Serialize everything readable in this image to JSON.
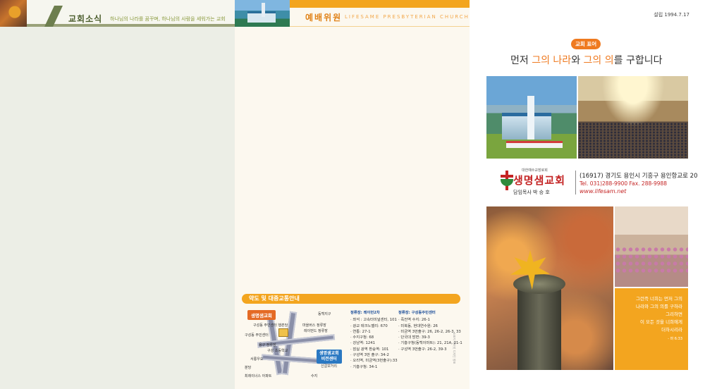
{
  "panel1": {
    "title": "교회소식",
    "subtitle": "하나님의 나라를 꿈꾸며, 하나님의 사람을 세워가는 교회"
  },
  "panel2": {
    "title": "예배위원",
    "subtitle": "LIFESAME PRESBYTERIAN CHURCH",
    "map": {
      "heading": "약도 및 대중교통안내",
      "church_label": "생명샘교회",
      "vision_label_1": "생명샘교회",
      "vision_label_2": "비전센터",
      "labels": [
        "구성동 주민센터 행촌당",
        "구성동 주민센터",
        "마을버스 정류장",
        "레이먼드 정류장",
        "동백지구",
        "용구 정류장",
        "구성 초등학교",
        "서룡우오",
        "분당",
        "최레이너스 아파트",
        "수지",
        "신갈오거리"
      ]
    },
    "bus_left": {
      "title": "정류장: 레이먼2차",
      "items": [
        "· 좌석 : 고속터미널센터, 101",
        "· 광교 테크노밸리: 670",
        "· 연통: 27-1",
        "· 수지구청: 68",
        "· 강남역: 1241",
        "· 잠실 광역 환승역: 101",
        "· 구성역 3번 출구: 34-2",
        "· 오리역, 미금역(3번출구):33",
        "· 기흥구청: 34-1"
      ]
    },
    "bus_right": {
      "title": "정류장: 구성동주민센터",
      "items": [
        "· 죽전역 수지: 26-1",
        "· 미북동, 현대연수원: 26",
        "· 미금역 3번출구: 26, 26-2, 26-3, 33",
        "· 단국대 방면: 39-3",
        "· 기흥구청(동백이마트): 21, 21A, 21-1",
        "· 구성역 3번출구: 26-2, 39-3"
      ]
    },
    "side_note": "소표지 캐비넷 디자인 발표"
  },
  "panel3": {
    "established": "설립 1994.7.17",
    "motto_badge": "교회 표어",
    "motto_a": "먼저 ",
    "motto_b": "그의 나라",
    "motto_c": "와 ",
    "motto_d": "그의 의",
    "motto_e": "를 구합니다",
    "denomination": "대한예수교장로회",
    "church_name": "생명샘교회",
    "pastor": "담임목사  박 승 호",
    "address": "(16917) 경기도 용인시 기흥구 용인항교로 20",
    "tel": "Tel. 031)288-9900   Fax. 288-9988",
    "website": "www.lifesam.net",
    "verse_lines": [
      "그런즉 너희는 먼저 그의",
      "나라와 그의 의를 구하라",
      "그리하면",
      "이 모든 것을 너희에게",
      "더하시리라"
    ],
    "verse_ref": "- 마 6:33",
    "colors": {
      "accent": "#f3a51f",
      "brand_red": "#c42424",
      "olive": "#6d7e4e"
    }
  }
}
